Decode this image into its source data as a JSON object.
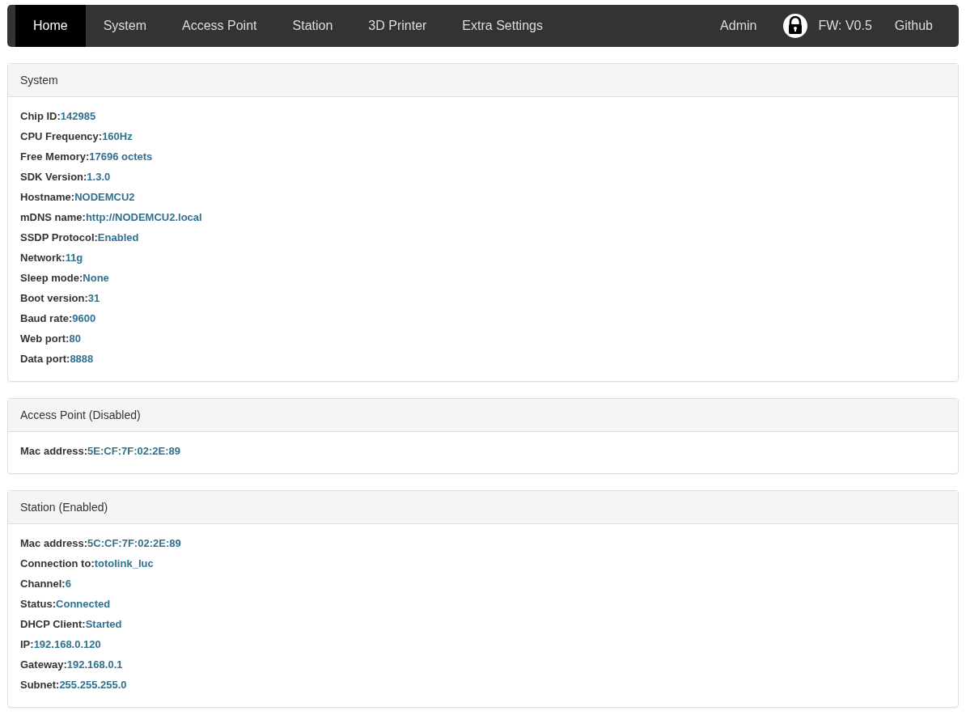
{
  "nav": {
    "items": [
      {
        "label": "Home",
        "selected": true
      },
      {
        "label": "System",
        "selected": false
      },
      {
        "label": "Access Point",
        "selected": false
      },
      {
        "label": "Station",
        "selected": false
      },
      {
        "label": "3D Printer",
        "selected": false
      },
      {
        "label": "Extra Settings",
        "selected": false
      }
    ],
    "right": {
      "admin": "Admin",
      "firmware": "FW: V0.5",
      "github": "Github"
    }
  },
  "panels": [
    {
      "title": "System",
      "rows": [
        {
          "label": "Chip ID:",
          "value": "142985"
        },
        {
          "label": "CPU Frequency:",
          "value": "160Hz"
        },
        {
          "label": "Free Memory:",
          "value": "17696 octets"
        },
        {
          "label": "SDK Version:",
          "value": "1.3.0"
        },
        {
          "label": "Hostname:",
          "value": "NODEMCU2"
        },
        {
          "label": "mDNS name:",
          "value": "http://NODEMCU2.local"
        },
        {
          "label": "SSDP Protocol:",
          "value": "Enabled"
        },
        {
          "label": "Network:",
          "value": "11g"
        },
        {
          "label": "Sleep mode:",
          "value": "None"
        },
        {
          "label": "Boot version:",
          "value": "31"
        },
        {
          "label": "Baud rate:",
          "value": "9600"
        },
        {
          "label": "Web port:",
          "value": "80"
        },
        {
          "label": "Data port:",
          "value": "8888"
        }
      ]
    },
    {
      "title": "Access Point (Disabled)",
      "rows": [
        {
          "label": "Mac address:",
          "value": "5E:CF:7F:02:2E:89"
        }
      ]
    },
    {
      "title": "Station (Enabled)",
      "rows": [
        {
          "label": "Mac address:",
          "value": "5C:CF:7F:02:2E:89"
        },
        {
          "label": "Connection to:",
          "value": "totolink_luc"
        },
        {
          "label": "Channel:",
          "value": "6"
        },
        {
          "label": "Status:",
          "value": "Connected"
        },
        {
          "label": "DHCP Client:",
          "value": "Started"
        },
        {
          "label": "IP:",
          "value": "192.168.0.120"
        },
        {
          "label": "Gateway:",
          "value": "192.168.0.1"
        },
        {
          "label": "Subnet:",
          "value": "255.255.255.0"
        }
      ]
    }
  ]
}
